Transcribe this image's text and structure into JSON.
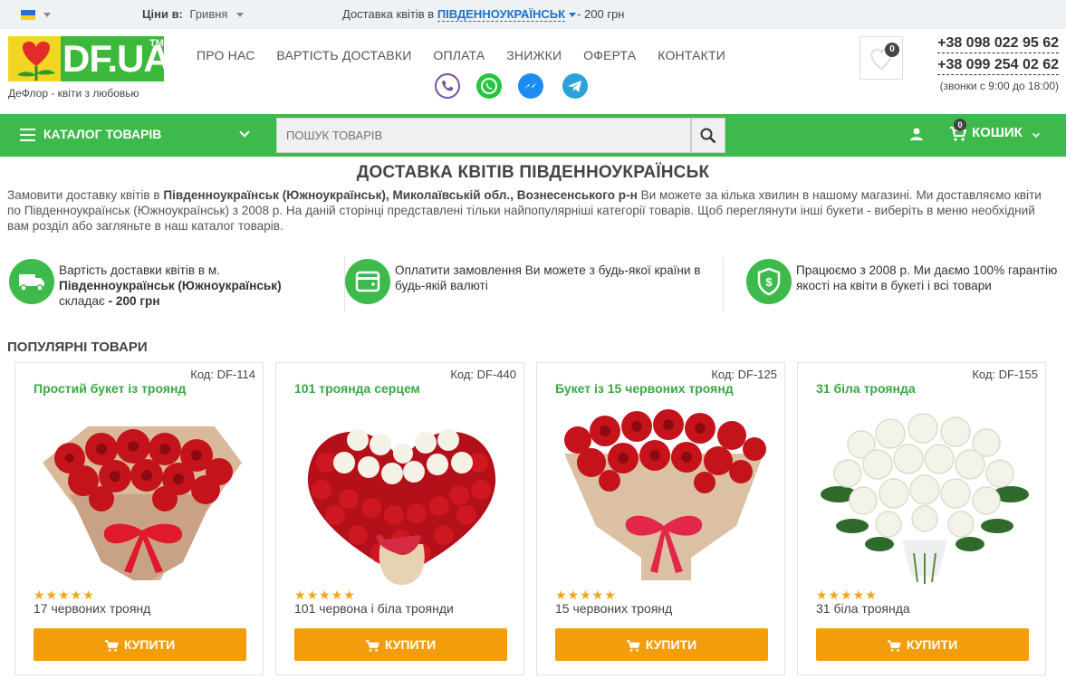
{
  "topbar": {
    "prices_label": "Ціни в:",
    "currency": "Гривня",
    "delivery_text": "Доставка квітів в",
    "delivery_city": "ПІВДЕННОУКРАЇНСЬК",
    "delivery_price": "- 200 грн"
  },
  "header": {
    "logo_text": "DF.UA",
    "logo_tm": "TM",
    "tagline": "ДеФлор - квіти з любовью",
    "nav": [
      "ПРО НАС",
      "ВАРТІСТЬ ДОСТАВКИ",
      "ОПЛАТА",
      "ЗНИЖКИ",
      "ОФЕРТА",
      "КОНТАКТИ"
    ],
    "wishlist_count": "0",
    "phones": [
      "+38 098 022 95 62",
      "+38 099 254 02 62"
    ],
    "hours": "(звонки с 9:00 до 18:00)"
  },
  "greenbar": {
    "catalog_label": "КАТАЛОГ ТОВАРІВ",
    "search_placeholder": "ПОШУК ТОВАРІВ",
    "cart_label": "КОШИК",
    "cart_count": "0"
  },
  "page": {
    "title": "ДОСТАВКА КВІТІВ ПІВДЕННОУКРАЇНСЬК",
    "intro_1": "Замовити доставку квітів в ",
    "intro_bold": "Південноукраїнськ (Южноукраїнськ), Миколаївській обл., Вознесенського р-н",
    "intro_2": " Ви можете за кілька хвилин в нашому магазині. Ми доставляємо квіти по Південноукраїнськ (Южноукраїнськ) з 2008 р. На даній сторінці представлені тільки найпопулярніші категорії товарів. Щоб переглянути інші букети - виберіть в меню необхідний вам розділ або загляньте в наш каталог товарів."
  },
  "features": {
    "f1_a": "Вартість доставки квітів в м.",
    "f1_city": "Південноукраїнськ (Южноукраїнськ)",
    "f1_b": "складає ",
    "f1_price": "- 200 грн",
    "f2": "Оплатити замовлення Ви можете з будь-якої країни в будь-якій валюті",
    "f3": "Працюємо з 2008 р. Ми даємо 100% гарантію якості на квіти в букеті і всі товари"
  },
  "popular": {
    "title": "ПОПУЛЯРНІ ТОВАРИ",
    "stars": "★★★★★",
    "buy_label": "КУПИТИ",
    "products": [
      {
        "code": "Код: DF-114",
        "name": "Простий букет із троянд",
        "sub": "17 червоних троянд"
      },
      {
        "code": "Код: DF-440",
        "name": "101 троянда серцем",
        "sub": "101 червона і біла троянди"
      },
      {
        "code": "Код: DF-125",
        "name": "Букет із 15 червоних троянд",
        "sub": "15 червоних троянд"
      },
      {
        "code": "Код: DF-155",
        "name": "31 біла троянда",
        "sub": "31 біла троянда"
      }
    ]
  },
  "colors": {
    "green": "#3dba4b",
    "orange_button": "#f49d0c",
    "link_blue": "#1a73c9"
  }
}
